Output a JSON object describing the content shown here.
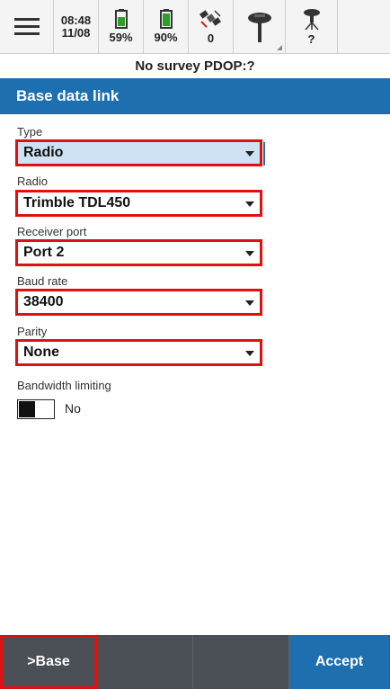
{
  "status_bar": {
    "time": "08:48",
    "date": "11/08",
    "battery1": "59%",
    "battery2": "90%",
    "satellites": "0",
    "base_status": "?"
  },
  "survey_status": "No survey  PDOP:?",
  "title": "Base data link",
  "form": {
    "type": {
      "label": "Type",
      "value": "Radio"
    },
    "radio": {
      "label": "Radio",
      "value": "Trimble TDL450"
    },
    "receiver_port": {
      "label": "Receiver port",
      "value": "Port 2"
    },
    "baud_rate": {
      "label": "Baud rate",
      "value": "38400"
    },
    "parity": {
      "label": "Parity",
      "value": "None"
    },
    "bandwidth": {
      "label": "Bandwidth limiting",
      "value": "No"
    }
  },
  "bottom_bar": {
    "base_label": ">Base",
    "accept_label": "Accept"
  },
  "colors": {
    "accent": "#1e6fb0",
    "highlight_border": "#e01010",
    "bottom_bar": "#4a4e55"
  }
}
